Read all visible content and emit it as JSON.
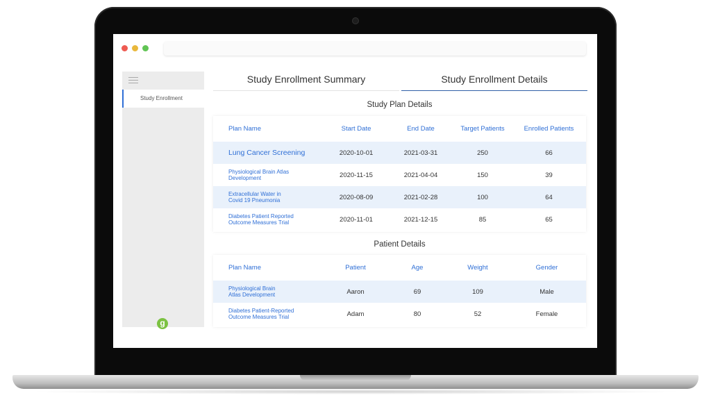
{
  "tabs": [
    {
      "label": "Study Enrollment Summary"
    },
    {
      "label": "Study Enrollment Details"
    }
  ],
  "sidebar": {
    "items": [
      {
        "label": "Study Enrollment"
      }
    ],
    "logo_letter": "g"
  },
  "study_plan": {
    "title": "Study Plan Details",
    "columns": [
      "Plan Name",
      "Start Date",
      "End Date",
      "Target Patients",
      "Enrolled Patients"
    ],
    "rows": [
      {
        "plan": "Lung Cancer Screening",
        "start": "2020-10-01",
        "end": "2021-03-31",
        "target": "250",
        "enrolled": "66"
      },
      {
        "plan": "Physiological Brain Atlas Development",
        "start": "2020-11-15",
        "end": "2021-04-04",
        "target": "150",
        "enrolled": "39"
      },
      {
        "plan": "Extracellular Water in Covid 19 Pneumonia",
        "start": "2020-08-09",
        "end": "2021-02-28",
        "target": "100",
        "enrolled": "64"
      },
      {
        "plan": "Diabetes Patient Reported Outcome Measures Trial",
        "start": "2020-11-01",
        "end": "2021-12-15",
        "target": "85",
        "enrolled": "65"
      }
    ]
  },
  "patients": {
    "title": "Patient Details",
    "columns": [
      "Plan Name",
      "Patient",
      "Age",
      "Weight",
      "Gender"
    ],
    "rows": [
      {
        "plan": "Physiological Brain Atlas Development",
        "patient": "Aaron",
        "age": "69",
        "weight": "109",
        "gender": "Male"
      },
      {
        "plan": "Diabetes Patient-Reported Outcome Measures Trial",
        "patient": "Adam",
        "age": "80",
        "weight": "52",
        "gender": "Female"
      }
    ]
  },
  "colors": {
    "accent": "#2f6fd6",
    "row_alt": "#e9f1fb",
    "sidebar": "#ececec"
  }
}
